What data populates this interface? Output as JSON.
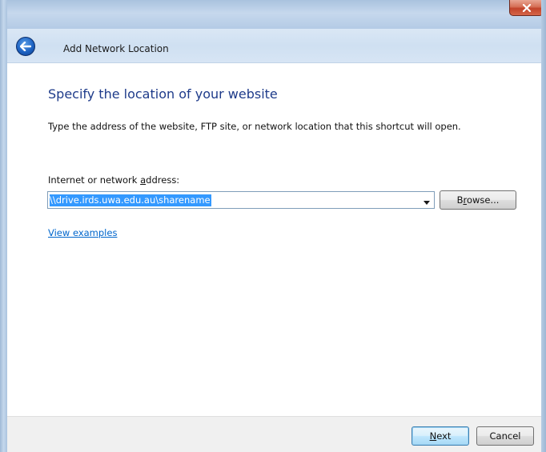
{
  "window": {
    "close_glyph": "x"
  },
  "header": {
    "title": "Add Network Location"
  },
  "main": {
    "heading": "Specify the location of your website",
    "instruction": "Type the address of the website, FTP site, or network location that this shortcut will open.",
    "address": {
      "label_prefix": "Internet or network ",
      "label_mnemonic": "a",
      "label_suffix": "ddress:",
      "value": "\\\\drive.irds.uwa.edu.au\\sharename",
      "selected": true
    },
    "browse": {
      "label_prefix": "B",
      "label_mnemonic": "r",
      "label_suffix": "owse..."
    },
    "view_examples_label": "View examples"
  },
  "footer": {
    "next": {
      "label_mnemonic": "N",
      "label_suffix": "ext"
    },
    "cancel_label": "Cancel"
  },
  "icons": {
    "back": "back-arrow-icon",
    "close": "close-icon",
    "dropdown": "chevron-down-icon"
  },
  "colors": {
    "heading": "#1e3b8a",
    "link": "#0066cc",
    "selection": "#3399ff",
    "close_button": "#c2432a"
  }
}
